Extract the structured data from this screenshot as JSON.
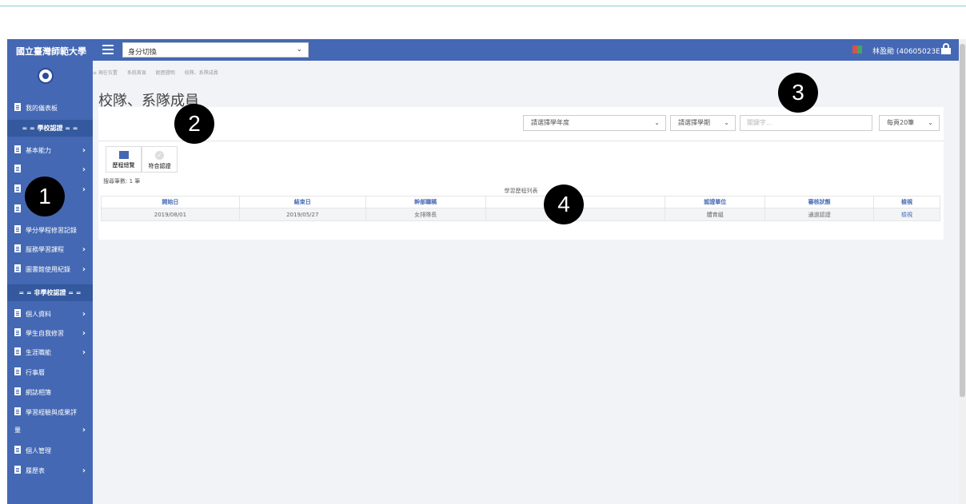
{
  "header": {
    "brand": "國立臺灣師範大學",
    "role_select": "身分切換",
    "user": "林盈勛 (40605023E)"
  },
  "sidebar": {
    "dashboard": "我的儀表板",
    "school_header": "= = 學校認證 = =",
    "school_items": [
      "基本能力",
      "",
      "",
      "",
      "學分學程修習記錄",
      "服務學習課程",
      "圖書館使用紀錄"
    ],
    "nonschool_header": "= = 非學校認證 = =",
    "nonschool_items": [
      "個人資料",
      "學生自我修習",
      "生涯職能",
      "行事曆",
      "網誌相簿",
      "學習經驗與成果評",
      "量",
      "個人管理",
      "履歷表"
    ]
  },
  "breadcrumb": [
    "≡ 現在位置",
    "系統首頁",
    "經歷證明",
    "校隊、系隊成員"
  ],
  "page": {
    "title": "校隊、系隊成員",
    "year_select": "請選擇學年度",
    "semester_select": "請選擇學期",
    "keyword_placeholder": "關鍵字...",
    "per_page": "每頁20筆"
  },
  "toolbar": {
    "history_label": "歷程總覽",
    "approve_label": "符合認證"
  },
  "table": {
    "count_label": "搜尋筆數: 1 筆",
    "caption": "學習歷程列表",
    "headers": [
      "開始日",
      "結束日",
      "幹部職稱",
      "",
      "認證單位",
      "審核狀態",
      "檢視"
    ],
    "rows": [
      [
        "2019/08/01",
        "2019/05/27",
        "女排隊長",
        "",
        "體育組",
        "通過認證",
        "檢視"
      ]
    ]
  },
  "callouts": [
    "1",
    "2",
    "3",
    "4"
  ]
}
